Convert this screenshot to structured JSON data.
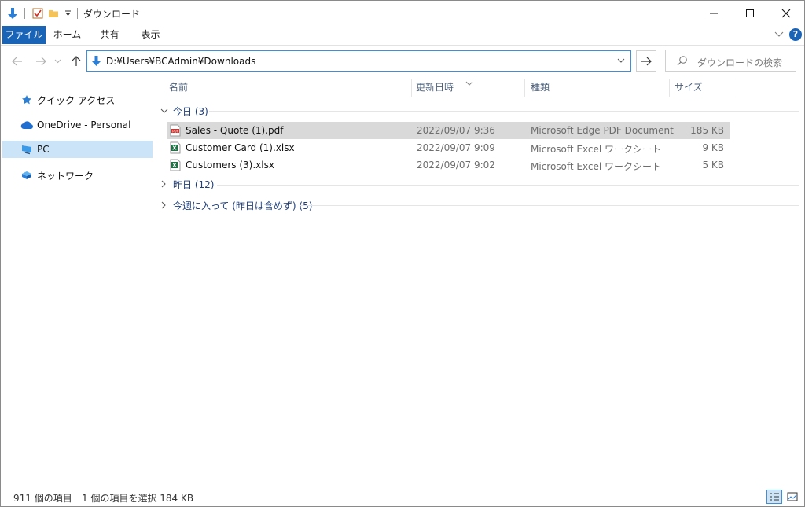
{
  "window": {
    "title": "ダウンロード",
    "icons": [
      "down-arrow-icon",
      "checkmark-properties-icon",
      "folder-icon",
      "dropdown-caret-icon"
    ],
    "controls": [
      "minimize-icon",
      "maximize-icon",
      "close-icon"
    ]
  },
  "ribbon": {
    "tabs": [
      "ファイル",
      "ホーム",
      "共有",
      "表示"
    ],
    "help": "?"
  },
  "address": {
    "path": "D:¥Users¥BCAdmin¥Downloads",
    "search_placeholder": "ダウンロードの検索"
  },
  "nav": {
    "items": [
      {
        "label": "クイック アクセス",
        "icon": "star-icon"
      },
      {
        "label": "OneDrive - Personal",
        "icon": "cloud-icon"
      },
      {
        "label": "PC",
        "icon": "computer-icon",
        "selected": true
      },
      {
        "label": "ネットワーク",
        "icon": "network-icon"
      }
    ]
  },
  "columns": {
    "name": "名前",
    "date": "更新日時",
    "type": "種類",
    "size": "サイズ"
  },
  "groups": {
    "today": "今日 (3)",
    "yesterday": "昨日 (12)",
    "thisweek": "今週に入って (昨日は含めず) (5)"
  },
  "files": [
    {
      "name": "Sales - Quote (1).pdf",
      "date": "2022/09/07 9:36",
      "type": "Microsoft Edge PDF Document",
      "size": "185 KB",
      "icon": "pdf-icon",
      "selected": true
    },
    {
      "name": "Customer Card (1).xlsx",
      "date": "2022/09/07 9:09",
      "type": "Microsoft Excel ワークシート",
      "size": "9 KB",
      "icon": "excel-icon"
    },
    {
      "name": "Customers (3).xlsx",
      "date": "2022/09/07 9:02",
      "type": "Microsoft Excel ワークシート",
      "size": "5 KB",
      "icon": "excel-icon"
    }
  ],
  "status": {
    "count": "911 個の項目",
    "selection": "1 個の項目を選択 184 KB"
  },
  "colors": {
    "file_tab": "#1a64b8",
    "nav_selected": "#cce4f7",
    "row_selected": "#d9d9d9",
    "accent": "#3c8fd9"
  }
}
